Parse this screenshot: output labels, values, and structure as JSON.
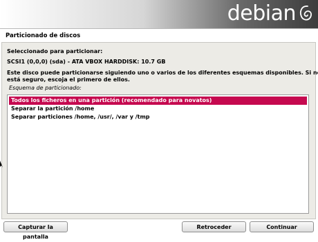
{
  "header": {
    "brand": "debian"
  },
  "page": {
    "title": "Particionado de discos"
  },
  "content": {
    "selected_label": "Seleccionado para particionar:",
    "disk_info": "SCSI1 (0,0,0) (sda) - ATA VBOX HARDDISK: 10.7 GB",
    "description_line1": "Este disco puede particionarse siguiendo uno o varios de los diferentes esquemas disponibles. Si no",
    "description_line2": "está seguro, escoja el primero de ellos.",
    "scheme_label": "Esquema de particionado:"
  },
  "options": [
    {
      "label": "Todos los ficheros en una partición (recomendado para novatos)",
      "selected": true
    },
    {
      "label": "Separar la partición /home",
      "selected": false
    },
    {
      "label": "Separar particiones /home, /usr/, /var y /tmp",
      "selected": false
    }
  ],
  "buttons": {
    "screenshot": "Capturar la pantalla",
    "back": "Retroceder",
    "continue": "Continuar"
  },
  "colors": {
    "selection": "#c5094f",
    "panel": "#ecebe6"
  }
}
